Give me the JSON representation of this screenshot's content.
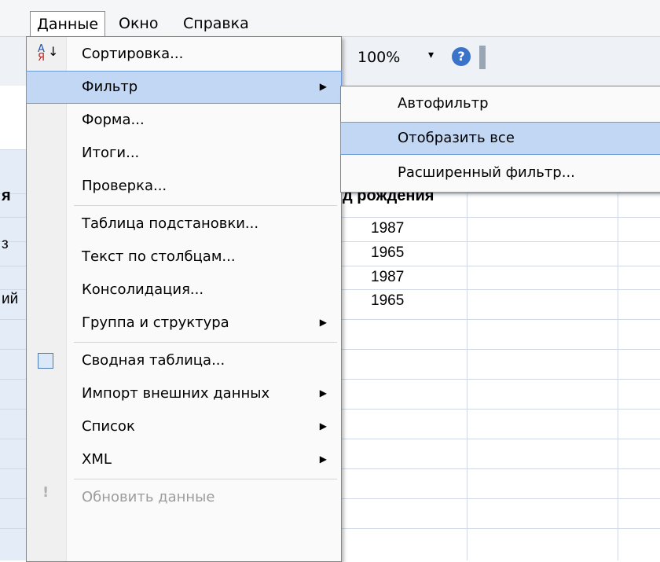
{
  "menubar": {
    "items": [
      {
        "label": "Данные",
        "active": true
      },
      {
        "label": "Окно",
        "active": false
      },
      {
        "label": "Справка",
        "active": false
      }
    ]
  },
  "toolbar": {
    "zoom": "100%"
  },
  "sheet": {
    "header": "д рождения",
    "values": [
      "1987",
      "1965",
      "1987",
      "1965"
    ],
    "edge_fragments": [
      "я",
      "з",
      "ий"
    ]
  },
  "menu": {
    "items": [
      {
        "label": "Сортировка...",
        "icon": "sort-icon",
        "submenu": false,
        "highlight": false,
        "disabled": false
      },
      {
        "label": "Фильтр",
        "submenu": true,
        "highlight": true,
        "disabled": false
      },
      {
        "label": "Форма...",
        "submenu": false,
        "highlight": false,
        "disabled": false
      },
      {
        "label": "Итоги...",
        "submenu": false,
        "highlight": false,
        "disabled": false
      },
      {
        "label": "Проверка...",
        "submenu": false,
        "highlight": false,
        "disabled": false
      },
      {
        "label": "Таблица подстановки...",
        "submenu": false,
        "highlight": false,
        "disabled": false
      },
      {
        "label": "Текст по столбцам...",
        "submenu": false,
        "highlight": false,
        "disabled": false
      },
      {
        "label": "Консолидация...",
        "submenu": false,
        "highlight": false,
        "disabled": false
      },
      {
        "label": "Группа и структура",
        "submenu": true,
        "highlight": false,
        "disabled": false
      },
      {
        "label": "Сводная таблица...",
        "icon": "pivot-table-icon",
        "submenu": false,
        "highlight": false,
        "disabled": false
      },
      {
        "label": "Импорт внешних данных",
        "submenu": true,
        "highlight": false,
        "disabled": false
      },
      {
        "label": "Список",
        "submenu": true,
        "highlight": false,
        "disabled": false
      },
      {
        "label": "XML",
        "submenu": true,
        "highlight": false,
        "disabled": false
      },
      {
        "label": "Обновить данные",
        "icon": "refresh-icon",
        "submenu": false,
        "highlight": false,
        "disabled": true
      }
    ]
  },
  "submenu": {
    "items": [
      {
        "label": "Автофильтр",
        "highlight": false
      },
      {
        "label": "Отобразить все",
        "highlight": true
      },
      {
        "label": "Расширенный фильтр...",
        "highlight": false
      }
    ]
  },
  "colors": {
    "highlight": "#c1d7f3",
    "highlight_border": "#6d9ad8",
    "grid": "#d0d7e5"
  }
}
